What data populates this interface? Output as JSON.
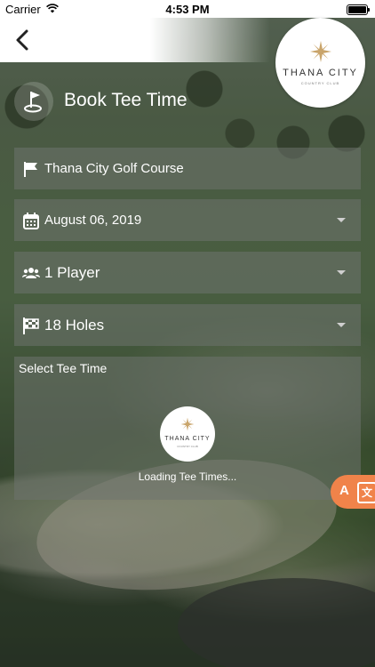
{
  "status_bar": {
    "carrier": "Carrier",
    "time": "4:53 PM"
  },
  "nav": {
    "back_icon": "chevron-left-icon"
  },
  "logo": {
    "name": "THANA CITY",
    "subtitle": "COUNTRY CLUB"
  },
  "page": {
    "title": "Book Tee Time",
    "title_icon": "golf-flag-icon"
  },
  "form": {
    "course": {
      "icon": "flag-icon",
      "value": "Thana City Golf Course"
    },
    "date": {
      "icon": "calendar-icon",
      "value": "August 06, 2019"
    },
    "players": {
      "icon": "users-icon",
      "value": "1 Player"
    },
    "holes": {
      "icon": "checkered-flag-icon",
      "value": "18 Holes"
    }
  },
  "tee_time": {
    "label": "Select Tee Time",
    "loader_logo_name": "THANA CITY",
    "loader_logo_subtitle": "COUNTRY CLUB",
    "loading_text": "Loading Tee Times..."
  },
  "translate_button": {
    "icon": "translate-icon",
    "latin": "A",
    "cjk": "文"
  },
  "colors": {
    "accent": "#f0834a",
    "row_bg": "#6e736e"
  }
}
